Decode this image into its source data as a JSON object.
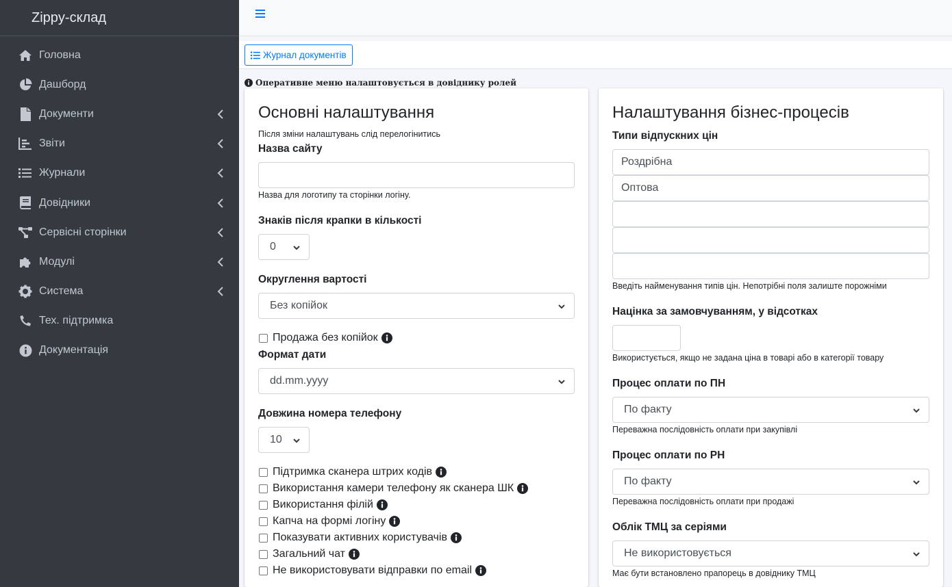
{
  "sidebar": {
    "brand": "Zippy-склад",
    "items": [
      {
        "label": "Головна",
        "icon": "home-icon",
        "chevron": false
      },
      {
        "label": "Дашборд",
        "icon": "chart-pie-icon",
        "chevron": false
      },
      {
        "label": "Документи",
        "icon": "file-icon",
        "chevron": true
      },
      {
        "label": "Звіти",
        "icon": "chart-bar-icon",
        "chevron": true
      },
      {
        "label": "Журнали",
        "icon": "list-icon",
        "chevron": true
      },
      {
        "label": "Довідники",
        "icon": "book-icon",
        "chevron": true
      },
      {
        "label": "Сервісні сторінки",
        "icon": "sitemap-icon",
        "chevron": true
      },
      {
        "label": "Модулі",
        "icon": "puzzle-icon",
        "chevron": true
      },
      {
        "label": "Система",
        "icon": "gear-icon",
        "chevron": true
      },
      {
        "label": "Тех. підтримка",
        "icon": "phone-icon",
        "chevron": false
      },
      {
        "label": "Документація",
        "icon": "info-icon",
        "chevron": false
      }
    ]
  },
  "toolbar": {
    "journal_button": "Журнал документів"
  },
  "hint": "Оперативне меню налаштовується в довіднику ролей",
  "left": {
    "title": "Основні налаштування",
    "subtitle": "Після зміни налаштувань слід перелогінитись",
    "site_name_label": "Назва сайту",
    "site_name_value": "",
    "site_name_help": "Назва для логотипу та сторінки логіну.",
    "decimals_label": "Знаків після крапки в кількості",
    "decimals_value": "0",
    "rounding_label": "Округлення вартості",
    "rounding_value": "Без копійок",
    "sale_no_kopecks": "Продажа без копійок",
    "date_format_label": "Формат дати",
    "date_format_value": "dd.mm.yyyy",
    "phone_length_label": "Довжина номера телефону",
    "phone_length_value": "10",
    "checks": [
      "Підтримка сканера штрих кодів",
      "Використання камери телефону як сканера ШК",
      "Використання філій",
      "Капча на формі логіну",
      "Показувати активних користувачів",
      "Загальний чат",
      "Не використовувати відправки по email"
    ]
  },
  "right": {
    "title": "Налаштування бізнес-процесів",
    "price_types_label": "Типи відпускних цін",
    "price_types": [
      "Роздрібна",
      "Оптова",
      "",
      "",
      ""
    ],
    "price_types_help": "Введіть найменування типів цін. Непотрібні поля залиште порожніми",
    "markup_label": "Націнка за замовчуванням, у відсотках",
    "markup_value": "",
    "markup_help": "Використується, якщо не задана ціна в товарі або в категорії товару",
    "pay_pn_label": "Процес оплати по ПН",
    "pay_pn_value": "По факту",
    "pay_pn_help": "Переважна послідовність оплати при закупівлі",
    "pay_rn_label": "Процес оплати по РН",
    "pay_rn_value": "По факту",
    "pay_rn_help": "Переважна послідовність оплати при продажі",
    "series_label": "Облік ТМЦ за серіями",
    "series_value": "Не використовується",
    "series_help": "Має бути встановлено прапорець в довіднику ТМЦ"
  }
}
